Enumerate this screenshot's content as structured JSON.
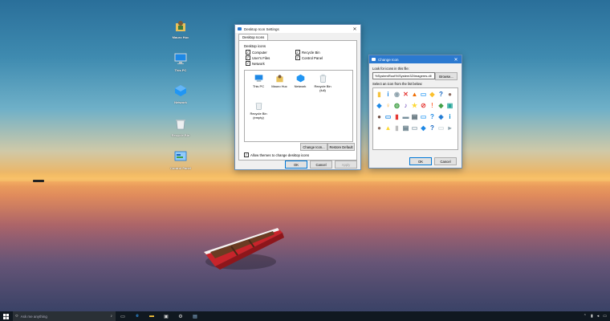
{
  "desktop": {
    "icons": [
      {
        "label": "Mauro Huc",
        "kind": "user"
      },
      {
        "label": "This PC",
        "kind": "pc"
      },
      {
        "label": "Network",
        "kind": "network"
      },
      {
        "label": "Recycle Bin",
        "kind": "bin"
      },
      {
        "label": "Control Panel",
        "kind": "control"
      }
    ]
  },
  "settings_window": {
    "title": "Desktop Icon Settings",
    "tab": "Desktop Icons",
    "group_label": "Desktop icons",
    "checkboxes": [
      {
        "label": "Computer",
        "checked": true
      },
      {
        "label": "Recycle Bin",
        "checked": true
      },
      {
        "label": "User's Files",
        "checked": true
      },
      {
        "label": "Control Panel",
        "checked": true
      },
      {
        "label": "Network",
        "checked": true
      }
    ],
    "preview_icons": [
      {
        "label": "This PC",
        "kind": "pc"
      },
      {
        "label": "Mauro Huc",
        "kind": "user"
      },
      {
        "label": "Network",
        "kind": "network"
      },
      {
        "label": "Recycle Bin (full)",
        "kind": "bin"
      },
      {
        "label": "Recycle Bin (empty)",
        "kind": "bin"
      }
    ],
    "change_icon_label": "Change Icon...",
    "restore_default_label": "Restore Default",
    "allow_themes_label": "Allow themes to change desktop icons",
    "allow_themes_checked": true,
    "ok_label": "OK",
    "cancel_label": "Cancel",
    "apply_label": "Apply"
  },
  "change_icon_window": {
    "title": "Change Icon",
    "look_for_label": "Look for icons in this file:",
    "path_value": "%SystemRoot%\\System32\\imageres.dll",
    "browse_label": "Browse...",
    "select_label": "Select an icon from the list below:",
    "ok_label": "OK",
    "cancel_label": "Cancel"
  },
  "taskbar": {
    "search_placeholder": "Ask me anything",
    "apps": [
      "task-view",
      "edge",
      "file-explorer",
      "store",
      "settings",
      "explorer-window"
    ]
  },
  "colors": {
    "accent": "#0078d7",
    "taskbar": "#101820"
  }
}
